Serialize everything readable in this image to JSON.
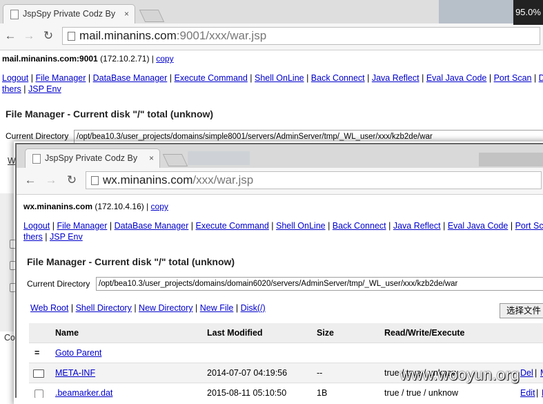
{
  "back_window": {
    "tab_title": "JspSpy Private Codz By",
    "tab_close": "×",
    "url_host": "mail.minanins.com",
    "url_rest": ":9001/xxx/war.jsp",
    "host_bold": "mail.minanins.com:9001",
    "host_ip": " (172.10.2.71) | ",
    "copy": "copy",
    "links": [
      "Logout",
      "File Manager",
      "DataBase Manager",
      "Execute Command",
      "Shell OnLine",
      "Back Connect",
      "Java Reflect",
      "Eval Java Code",
      "Port Scan",
      "Down"
    ],
    "links2": [
      "thers",
      "JSP Env"
    ],
    "heading": "File Manager - Current disk \"/\" total (unknow)",
    "dir_label": "Current Directory",
    "dir_value": "/opt/bea10.3/user_projects/domains/simple8001/servers/AdminServer/tmp/_WL_user/xxx/kzb2de/war",
    "stub_w": "W",
    "stub_co": "Co",
    "zoom": "95.0%"
  },
  "front_window": {
    "tab_title": "JspSpy Private Codz By",
    "tab_close": "×",
    "url_host": "wx.minanins.com",
    "url_rest": "/xxx/war.jsp",
    "host_bold": "wx.minanins.com",
    "host_ip": " (172.10.4.16) | ",
    "copy": "copy",
    "links": [
      "Logout",
      "File Manager",
      "DataBase Manager",
      "Execute Command",
      "Shell OnLine",
      "Back Connect",
      "Java Reflect",
      "Eval Java Code",
      "Port Scan"
    ],
    "links2": [
      "thers",
      "JSP Env"
    ],
    "heading": "File Manager - Current disk \"/\" total (unknow)",
    "dir_label": "Current Directory",
    "dir_value": "/opt/bea10.3/user_projects/domains/domain6020/servers/AdminServer/tmp/_WL_user/xxx/kzb2de/war",
    "sublinks": [
      "Web Root",
      "Shell Directory",
      "New Directory",
      "New File",
      "Disk(/)"
    ],
    "file_button": "选择文件",
    "columns": [
      "Name",
      "Last Modified",
      "Size",
      "Read/Write/Execute"
    ],
    "parent_marker": "=",
    "parent_label": "Goto Parent",
    "rows": [
      {
        "name": "META-INF",
        "modified": "2014-07-07 04:19:56",
        "size": "--",
        "rwx": "true / true / unknow",
        "action": "Del",
        "action2": "M"
      },
      {
        "name": ".beamarker.dat",
        "modified": "2015-08-11 05:10:50",
        "size": "1B",
        "rwx": "true / true / unknow",
        "action": "Edit",
        "action2": "D"
      }
    ]
  },
  "watermark": "www.wooyun.org"
}
